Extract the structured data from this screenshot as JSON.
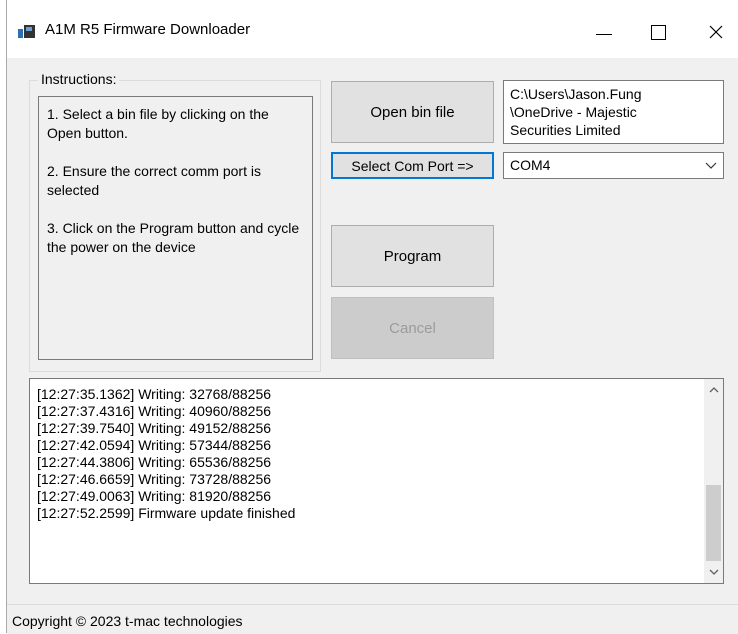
{
  "window": {
    "title": "A1M R5 Firmware Downloader",
    "minimize_label": "—",
    "close_label": "✕"
  },
  "instructions": {
    "group_label": "Instructions:",
    "steps": [
      "1. Select a bin file by clicking on the Open button.",
      "2. Ensure the correct comm port is selected",
      "3. Click on the Program button and cycle the power on the device"
    ]
  },
  "buttons": {
    "open": "Open bin file",
    "select_com": "Select Com Port =>",
    "program": "Program",
    "cancel": "Cancel"
  },
  "file_path": {
    "lines": [
      "C:\\Users\\Jason.Fung",
      "\\OneDrive - Majestic",
      "Securities Limited"
    ]
  },
  "com_port": {
    "selected": "COM4"
  },
  "log": {
    "lines": [
      "[12:27:35.1362] Writing: 32768/88256",
      "[12:27:37.4316] Writing: 40960/88256",
      "[12:27:39.7540] Writing: 49152/88256",
      "[12:27:42.0594] Writing: 57344/88256",
      "[12:27:44.3806] Writing: 65536/88256",
      "[12:27:46.6659] Writing: 73728/88256",
      "[12:27:49.0063] Writing: 81920/88256",
      "[12:27:52.2599] Firmware update finished"
    ]
  },
  "status": {
    "copyright": "Copyright © 2023 t-mac technologies"
  },
  "colors": {
    "focus_border": "#0078d7",
    "window_bg": "#f0f0f0",
    "disabled_text": "#9c9c9c"
  }
}
